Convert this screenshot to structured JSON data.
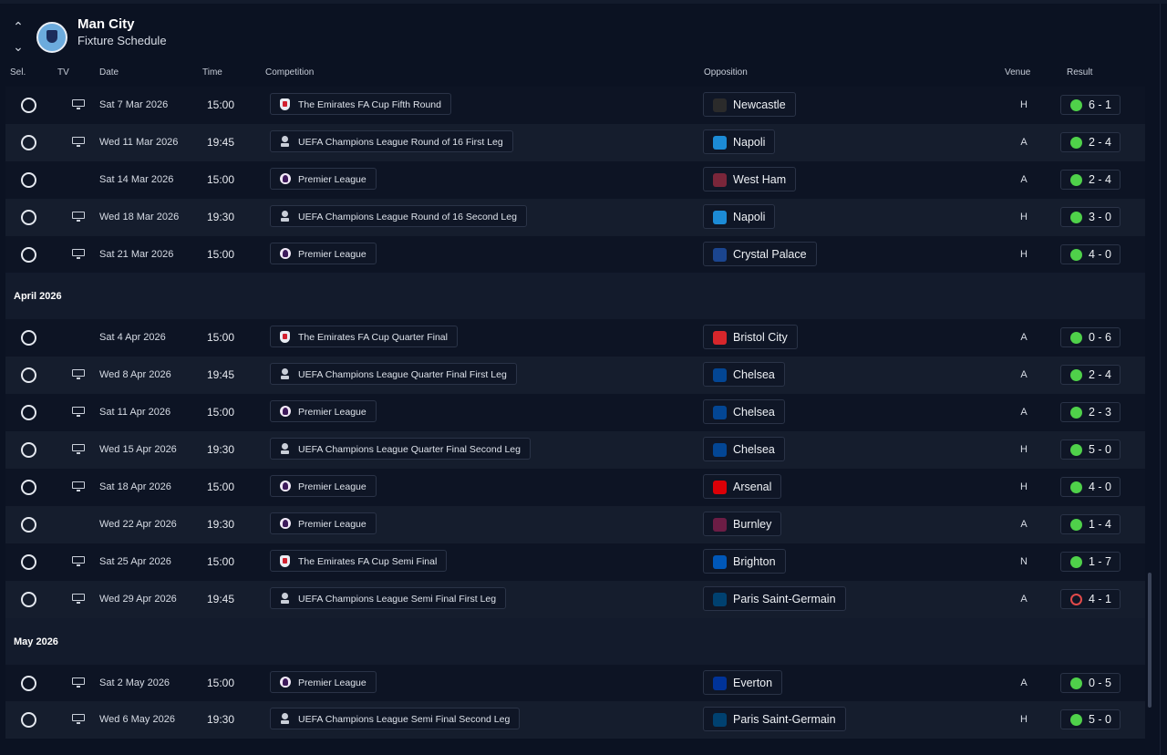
{
  "header": {
    "club_name": "Man City",
    "subtitle": "Fixture Schedule"
  },
  "columns": {
    "sel": "Sel.",
    "tv": "TV",
    "date": "Date",
    "time": "Time",
    "competition": "Competition",
    "opposition": "Opposition",
    "venue": "Venue",
    "result": "Result"
  },
  "months": {
    "april": "April 2026",
    "may": "May 2026"
  },
  "colors": {
    "win": "#4fd14a",
    "loss": "#e24a4a",
    "background": "#0b1222"
  },
  "fixtures": [
    {
      "date": "Sat 7 Mar 2026",
      "time": "15:00",
      "competition": "The Emirates FA Cup Fifth Round",
      "comp_icon": "fa-cup-icon",
      "opposition": "Newcastle",
      "venue": "H",
      "result": "6 - 1",
      "outcome": "win",
      "tv": true,
      "badge_color": "#2b2b2b"
    },
    {
      "date": "Wed 11 Mar 2026",
      "time": "19:45",
      "competition": "UEFA Champions League Round of 16  First Leg",
      "comp_icon": "champions-league-icon",
      "opposition": "Napoli",
      "venue": "A",
      "result": "2 - 4",
      "outcome": "win",
      "tv": true,
      "badge_color": "#1c8bd6"
    },
    {
      "date": "Sat 14 Mar 2026",
      "time": "15:00",
      "competition": "Premier League",
      "comp_icon": "premier-league-icon",
      "opposition": "West Ham",
      "venue": "A",
      "result": "2 - 4",
      "outcome": "win",
      "tv": false,
      "badge_color": "#7a263a"
    },
    {
      "date": "Wed 18 Mar 2026",
      "time": "19:30",
      "competition": "UEFA Champions League Round of 16  Second Leg",
      "comp_icon": "champions-league-icon",
      "opposition": "Napoli",
      "venue": "H",
      "result": "3 - 0",
      "outcome": "win",
      "tv": true,
      "badge_color": "#1c8bd6"
    },
    {
      "date": "Sat 21 Mar 2026",
      "time": "15:00",
      "competition": "Premier League",
      "comp_icon": "premier-league-icon",
      "opposition": "Crystal Palace",
      "venue": "H",
      "result": "4 - 0",
      "outcome": "win",
      "tv": true,
      "badge_color": "#1b458f"
    },
    {
      "date": "Sat 4 Apr 2026",
      "time": "15:00",
      "competition": "The Emirates FA Cup Quarter Final",
      "comp_icon": "fa-cup-icon",
      "opposition": "Bristol City",
      "venue": "A",
      "result": "0 - 6",
      "outcome": "win",
      "tv": false,
      "badge_color": "#d7262b"
    },
    {
      "date": "Wed 8 Apr 2026",
      "time": "19:45",
      "competition": "UEFA Champions League Quarter Final First Leg",
      "comp_icon": "champions-league-icon",
      "opposition": "Chelsea",
      "venue": "A",
      "result": "2 - 4",
      "outcome": "win",
      "tv": true,
      "badge_color": "#034694"
    },
    {
      "date": "Sat 11 Apr 2026",
      "time": "15:00",
      "competition": "Premier League",
      "comp_icon": "premier-league-icon",
      "opposition": "Chelsea",
      "venue": "A",
      "result": "2 - 3",
      "outcome": "win",
      "tv": true,
      "badge_color": "#034694"
    },
    {
      "date": "Wed 15 Apr 2026",
      "time": "19:30",
      "competition": "UEFA Champions League Quarter Final Second Leg",
      "comp_icon": "champions-league-icon",
      "opposition": "Chelsea",
      "venue": "H",
      "result": "5 - 0",
      "outcome": "win",
      "tv": true,
      "badge_color": "#034694"
    },
    {
      "date": "Sat 18 Apr 2026",
      "time": "15:00",
      "competition": "Premier League",
      "comp_icon": "premier-league-icon",
      "opposition": "Arsenal",
      "venue": "H",
      "result": "4 - 0",
      "outcome": "win",
      "tv": true,
      "badge_color": "#db0007"
    },
    {
      "date": "Wed 22 Apr 2026",
      "time": "19:30",
      "competition": "Premier League",
      "comp_icon": "premier-league-icon",
      "opposition": "Burnley",
      "venue": "A",
      "result": "1 - 4",
      "outcome": "win",
      "tv": false,
      "badge_color": "#6c1d45"
    },
    {
      "date": "Sat 25 Apr 2026",
      "time": "15:00",
      "competition": "The Emirates FA Cup Semi Final",
      "comp_icon": "fa-cup-icon",
      "opposition": "Brighton",
      "venue": "N",
      "result": "1 - 7",
      "outcome": "win",
      "tv": true,
      "badge_color": "#0057b8"
    },
    {
      "date": "Wed 29 Apr 2026",
      "time": "19:45",
      "competition": "UEFA Champions League Semi Final First Leg",
      "comp_icon": "champions-league-icon",
      "opposition": "Paris Saint-Germain",
      "venue": "A",
      "result": "4 - 1",
      "outcome": "loss",
      "tv": true,
      "badge_color": "#004170"
    },
    {
      "date": "Sat 2 May 2026",
      "time": "15:00",
      "competition": "Premier League",
      "comp_icon": "premier-league-icon",
      "opposition": "Everton",
      "venue": "A",
      "result": "0 - 5",
      "outcome": "win",
      "tv": true,
      "badge_color": "#003399"
    },
    {
      "date": "Wed 6 May 2026",
      "time": "19:30",
      "competition": "UEFA Champions League Semi Final Second Leg",
      "comp_icon": "champions-league-icon",
      "opposition": "Paris Saint-Germain",
      "venue": "H",
      "result": "5 - 0",
      "outcome": "win",
      "tv": true,
      "badge_color": "#004170"
    }
  ]
}
